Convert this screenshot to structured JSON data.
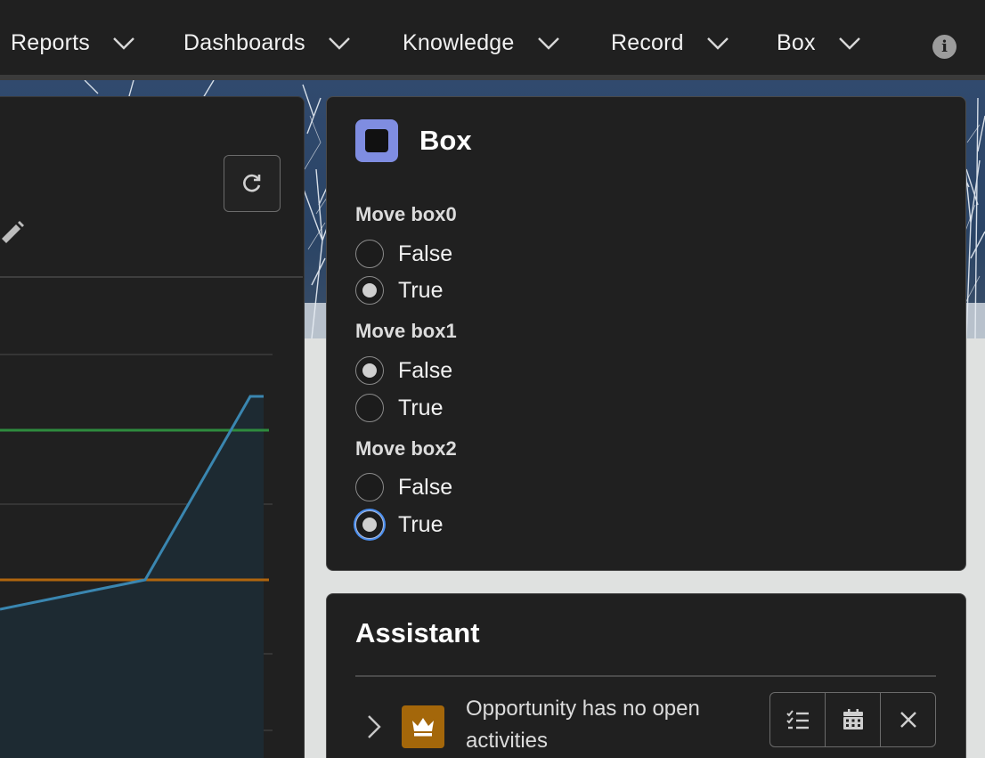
{
  "nav": {
    "items": [
      {
        "label": "Reports",
        "icon": "chevron-down-icon"
      },
      {
        "label": "Dashboards",
        "icon": "chevron-down-icon"
      },
      {
        "label": "Knowledge",
        "icon": "chevron-down-icon"
      },
      {
        "label": "Record",
        "icon": "chevron-down-icon"
      },
      {
        "label": "Box",
        "icon": "chevron-down-icon"
      }
    ],
    "info_icon": "info-icon",
    "info_glyph": "i"
  },
  "box_panel": {
    "title": "Box",
    "icon": "box-icon",
    "accent": "#7f8de1",
    "groups": [
      {
        "label": "Move box0",
        "options": [
          {
            "label": "False",
            "checked": false
          },
          {
            "label": "True",
            "checked": true
          }
        ]
      },
      {
        "label": "Move box1",
        "options": [
          {
            "label": "False",
            "checked": true
          },
          {
            "label": "True",
            "checked": false
          }
        ]
      },
      {
        "label": "Move box2",
        "options": [
          {
            "label": "False",
            "checked": false
          },
          {
            "label": "True",
            "checked": true,
            "focused": true
          }
        ]
      }
    ]
  },
  "assistant": {
    "title": "Assistant",
    "item_text": "Opportunity has no open activities",
    "item_icon": "crown-icon",
    "item_icon_color": "#a4670a",
    "actions": [
      "new-task-icon",
      "calendar-icon",
      "close-icon"
    ]
  },
  "chart_panel": {
    "refresh_icon": "refresh-icon",
    "edit_icon": "pencil-icon",
    "colors": {
      "series": "#3a86b0",
      "green_line": "#2e8b3e",
      "orange_line": "#b0650e",
      "fill": "#1d2a32"
    }
  }
}
